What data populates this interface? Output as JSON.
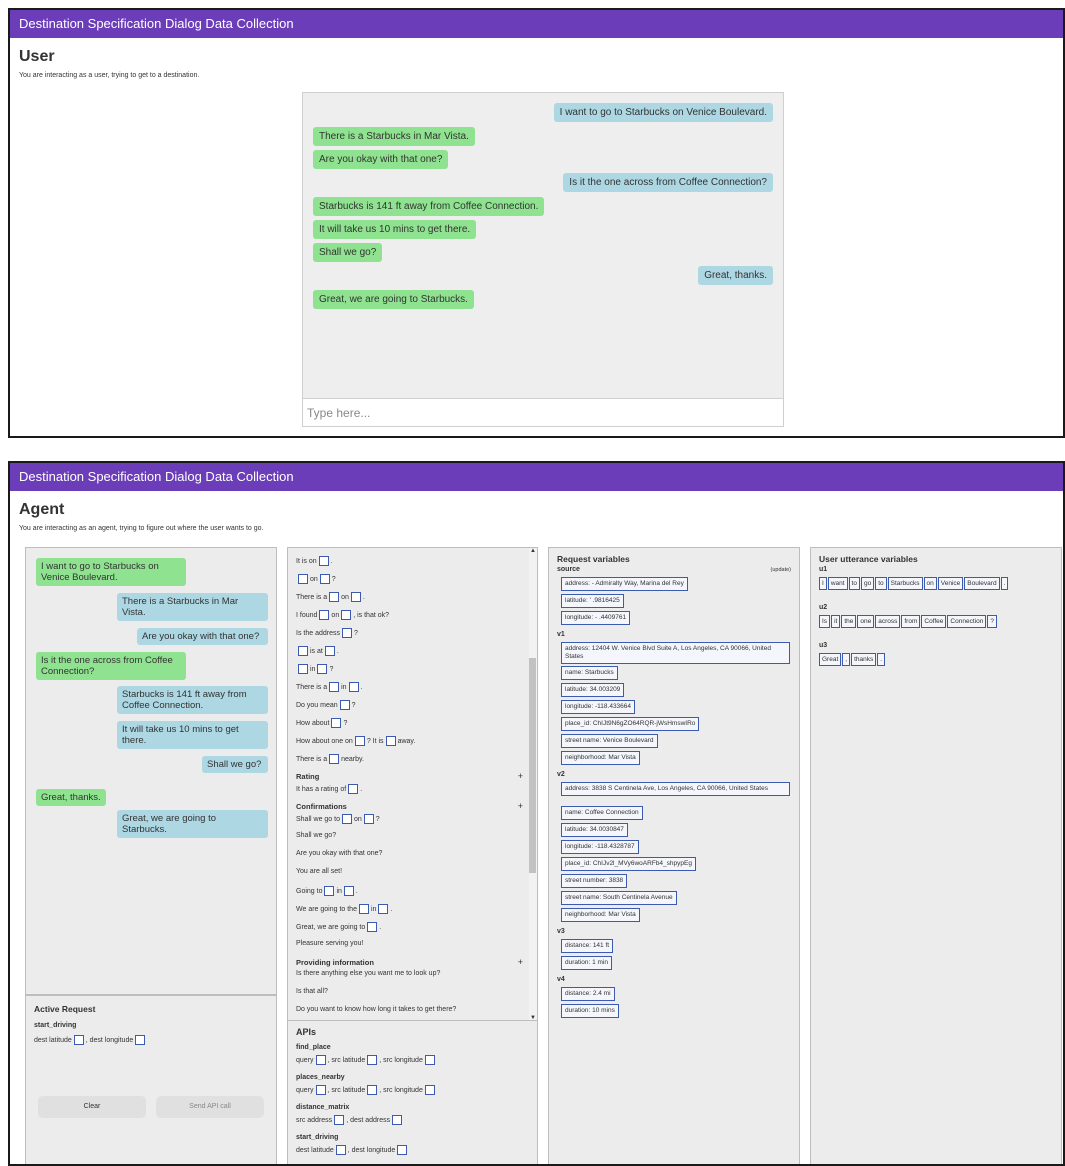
{
  "app_title": "Destination Specification Dialog Data Collection",
  "user_view": {
    "title": "User",
    "subtitle": "You are interacting as a user, trying to get to a destination.",
    "messages": [
      {
        "text": "I want to go to Starbucks on Venice Boulevard.",
        "side": "right"
      },
      {
        "text": "There is a Starbucks in Mar Vista.",
        "side": "left"
      },
      {
        "text": "Are you okay with that one?",
        "side": "left"
      },
      {
        "text": "Is it the one across from Coffee Connection?",
        "side": "right"
      },
      {
        "text": "Starbucks is 141 ft away from Coffee Connection.",
        "side": "left"
      },
      {
        "text": "It will take us 10 mins to get there.",
        "side": "left"
      },
      {
        "text": "Shall we go?",
        "side": "left"
      },
      {
        "text": "Great, thanks.",
        "side": "right"
      },
      {
        "text": "Great, we are going to Starbucks.",
        "side": "left"
      }
    ],
    "input_placeholder": "Type here..."
  },
  "agent_view": {
    "title": "Agent",
    "subtitle": "You are interacting as an agent, trying to figure out where the user wants to go.",
    "messages": [
      {
        "text": "I want to go to Starbucks on Venice Boulevard.",
        "side": "left"
      },
      {
        "text": "There is a Starbucks in Mar Vista.",
        "side": "right"
      },
      {
        "text": "Are you okay with that one?",
        "side": "right"
      },
      {
        "text": "Is it the one across from Coffee Connection?",
        "side": "left"
      },
      {
        "text": "Starbucks is 141 ft away from Coffee Connection.",
        "side": "right"
      },
      {
        "text": "It will take us 10 mins to get there.",
        "side": "right"
      },
      {
        "text": "Shall we go?",
        "side": "right"
      },
      {
        "text": "Great, thanks.",
        "side": "left"
      },
      {
        "text": "Great, we are going to Starbucks.",
        "side": "right"
      }
    ],
    "active_request": {
      "title": "Active Request",
      "name": "start_driving",
      "params": [
        "dest latitude",
        "dest longitude"
      ],
      "clear_label": "Clear",
      "send_label": "Send API call"
    },
    "templates": {
      "lines": [
        {
          "parts": [
            "It is on",
            "[]",
            "."
          ]
        },
        {
          "parts": [
            "[]",
            "on",
            "[]",
            "?"
          ]
        },
        {
          "parts": [
            "There is a",
            "[]",
            "on",
            "[]",
            "."
          ]
        },
        {
          "parts": [
            "I found",
            "[]",
            "on",
            "[]",
            ", is that ok?"
          ]
        },
        {
          "parts": [
            "Is the address",
            "[]",
            "?"
          ]
        },
        {
          "parts": [
            "[]",
            "is at",
            "[]",
            "."
          ]
        },
        {
          "parts": [
            "[]",
            "in",
            "[]",
            "?"
          ]
        },
        {
          "parts": [
            "There is a",
            "[]",
            "in",
            "[]",
            "."
          ]
        },
        {
          "parts": [
            "Do you mean",
            "[]",
            "?"
          ]
        },
        {
          "parts": [
            "How about",
            "[]",
            "?"
          ]
        },
        {
          "parts": [
            "How about one on",
            "[]",
            "? It is",
            "[]",
            "away."
          ]
        },
        {
          "parts": [
            "There is a",
            "[]",
            "nearby."
          ]
        }
      ],
      "rating_title": "Rating",
      "rating_lines": [
        {
          "parts": [
            "It has a rating of",
            "[]",
            "."
          ]
        }
      ],
      "confirmations_title": "Confirmations",
      "confirmation_lines": [
        {
          "parts": [
            "Shall we go to",
            "[]",
            "on",
            "[]",
            "?"
          ]
        },
        {
          "parts": [
            "Shall we go?"
          ]
        },
        {
          "parts": [
            "Are you okay with that one?"
          ]
        },
        {
          "parts": [
            "You are all set!"
          ]
        },
        {
          "parts": [
            "Going to",
            "[]",
            "in",
            "[]",
            "."
          ]
        },
        {
          "parts": [
            "We are going to the",
            "[]",
            "in",
            "[]",
            "."
          ]
        },
        {
          "parts": [
            "Great, we are going to",
            "[]",
            "."
          ]
        },
        {
          "parts": [
            "Pleasure serving you!"
          ]
        }
      ],
      "providing_title": "Providing information",
      "providing_lines": [
        {
          "parts": [
            "Is there anything else you want me to look up?"
          ]
        },
        {
          "parts": [
            "Is that all?"
          ]
        },
        {
          "parts": [
            "Do you want to know how long it takes to get there?"
          ]
        }
      ],
      "plus_glyph": "+"
    },
    "apis": {
      "title": "APIs",
      "items": [
        {
          "name": "find_place",
          "params": [
            "query",
            "src latitude",
            "src longitude"
          ]
        },
        {
          "name": "places_nearby",
          "params": [
            "query",
            "src latitude",
            "src longitude"
          ]
        },
        {
          "name": "distance_matrix",
          "params": [
            "src address",
            "dest address"
          ]
        },
        {
          "name": "start_driving",
          "params": [
            "dest latitude",
            "dest longitude"
          ]
        }
      ]
    },
    "request_variables": {
      "title": "Request variables",
      "update_label": "(update)",
      "groups": [
        {
          "name": "source",
          "fields": [
            "address: -  Admiralty Way, Marina del Rey",
            "latitude: ' .9816425",
            "longitude: -  .4409761"
          ]
        },
        {
          "name": "v1",
          "fields": [
            "address: 12404 W. Venice Blvd Suite A, Los Angeles, CA 90066, United States",
            "name: Starbucks",
            "latitude: 34.003209",
            "longitude: -118.433664",
            "place_id: ChIJt9N6gZO64RQR-jWsHmswIRo",
            "street name: Venice Boulevard",
            "neighborhood: Mar Vista"
          ]
        },
        {
          "name": "v2",
          "fields": [
            "address: 3838 S Centinela Ave, Los Angeles, CA 90066, United States",
            "name: Coffee Connection",
            "latitude: 34.0030847",
            "longitude: -118.4328787",
            "place_id: ChIJv2l_MVy6woARFb4_shpypEg",
            "street number: 3838",
            "street name: South Centinela Avenue",
            "neighborhood: Mar Vista"
          ]
        },
        {
          "name": "v3",
          "fields": [
            "distance: 141 ft",
            "duration: 1 min"
          ]
        },
        {
          "name": "v4",
          "fields": [
            "distance: 2.4 mi",
            "duration: 10 mins"
          ]
        }
      ]
    },
    "utterance_variables": {
      "title": "User utterance variables",
      "groups": [
        {
          "name": "u1",
          "tokens": [
            "I",
            "want",
            "to",
            "go",
            "to",
            "Starbucks",
            "on",
            "Venice",
            "Boulevard",
            "."
          ]
        },
        {
          "name": "u2",
          "tokens": [
            "Is",
            "it",
            "the",
            "one",
            "across",
            "from",
            "Coffee",
            "Connection",
            "?"
          ]
        },
        {
          "name": "u3",
          "tokens": [
            "Great",
            ",",
            "thanks",
            "."
          ]
        }
      ]
    }
  }
}
